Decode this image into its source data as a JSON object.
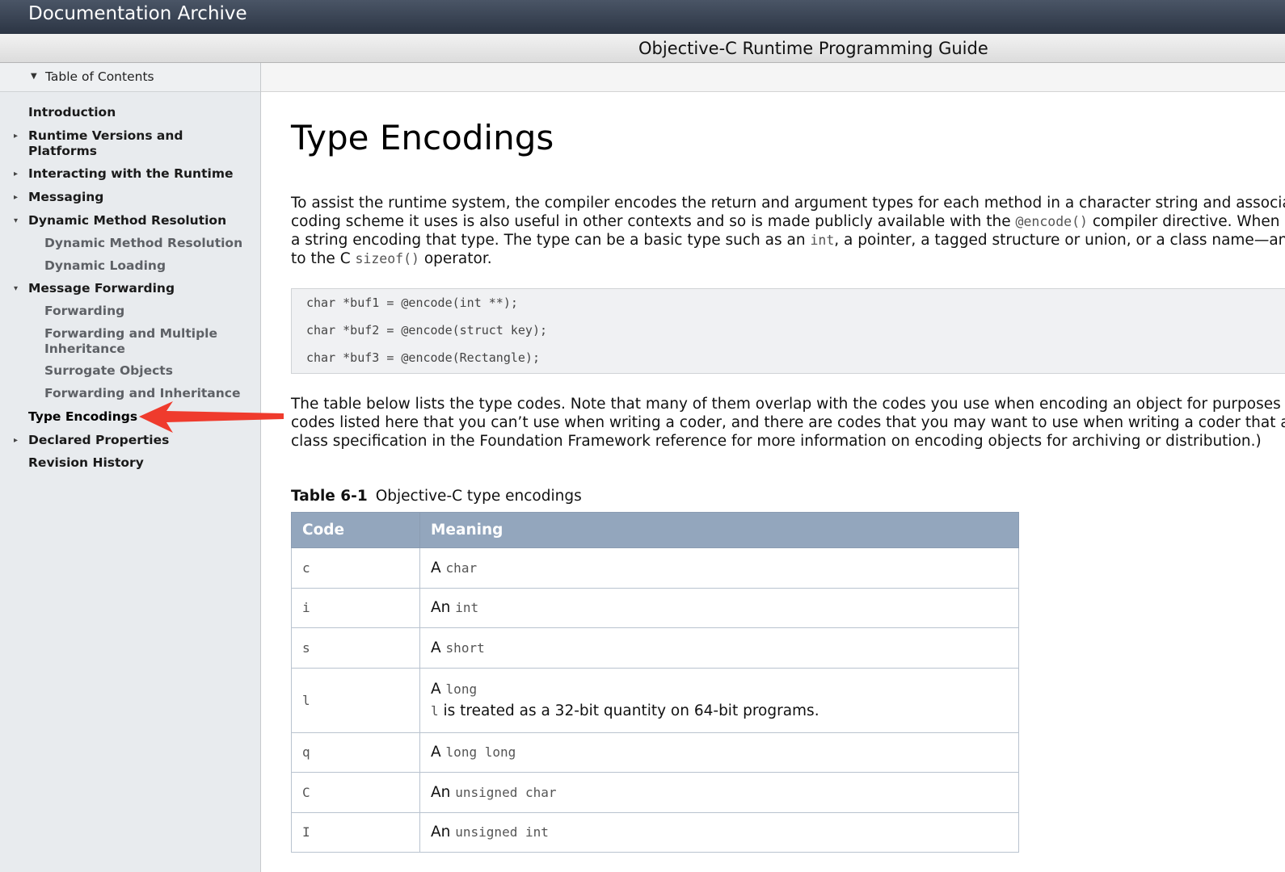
{
  "header": {
    "site_title": "Documentation Archive"
  },
  "document": {
    "title": "Objective-C Runtime Programming Guide"
  },
  "sidebar": {
    "toc_label": "Table of Contents",
    "items": [
      {
        "label": "Introduction",
        "level": 0,
        "arrow": ""
      },
      {
        "label": "Runtime Versions and",
        "label2": "Platforms",
        "level": 0,
        "arrow": "▸"
      },
      {
        "label": "Interacting with the Runtime",
        "level": 0,
        "arrow": "▸"
      },
      {
        "label": "Messaging",
        "level": 0,
        "arrow": "▸"
      },
      {
        "label": "Dynamic Method Resolution",
        "level": 0,
        "arrow": "▾"
      },
      {
        "label": "Dynamic Method Resolution",
        "level": 1,
        "arrow": ""
      },
      {
        "label": "Dynamic Loading",
        "level": 1,
        "arrow": ""
      },
      {
        "label": "Message Forwarding",
        "level": 0,
        "arrow": "▾"
      },
      {
        "label": "Forwarding",
        "level": 1,
        "arrow": ""
      },
      {
        "label": "Forwarding and Multiple",
        "label2": "Inheritance",
        "level": 1,
        "arrow": ""
      },
      {
        "label": "Surrogate Objects",
        "level": 1,
        "arrow": ""
      },
      {
        "label": "Forwarding and Inheritance",
        "level": 1,
        "arrow": ""
      },
      {
        "label": "Type Encodings",
        "level": 0,
        "arrow": "",
        "active": true
      },
      {
        "label": "Declared Properties",
        "level": 0,
        "arrow": "▸"
      },
      {
        "label": "Revision History",
        "level": 0,
        "arrow": ""
      }
    ]
  },
  "annotation": {
    "color": "#ef3b2d"
  },
  "main": {
    "title": "Type Encodings",
    "intro": {
      "l1": "To assist the runtime system, the compiler encodes the return and argument types for each method in a character string and associat",
      "l2a": "coding scheme it uses is also useful in other contexts and so is made publicly available with the ",
      "l2code": "@encode()",
      "l2b": " compiler directive. When",
      "l3a": "a string encoding that type. The type can be a basic type such as an ",
      "l3code": "int",
      "l3b": ", a pointer, a tagged structure or union, or a class name—any",
      "l4a": "to the C ",
      "l4code": "sizeof()",
      "l4b": " operator."
    },
    "code_lines": [
      "char *buf1 = @encode(int **);",
      "char *buf2 = @encode(struct key);",
      "char *buf3 = @encode(Rectangle);"
    ],
    "para2": {
      "l1": "The table below lists the type codes. Note that many of them overlap with the codes you use when encoding an object for purposes o",
      "l2": "codes listed here that you can’t use when writing a coder, and there are codes that you may want to use when writing a coder that are",
      "l3": "class specification in the Foundation Framework reference for more information on encoding objects for archiving or distribution.)"
    },
    "table": {
      "caption_num": "Table 6-1",
      "caption_text": "Objective-C type encodings",
      "headers": [
        "Code",
        "Meaning"
      ],
      "rows": [
        {
          "code": "c",
          "prefix": "A ",
          "type": "char"
        },
        {
          "code": "i",
          "prefix": "An ",
          "type": "int"
        },
        {
          "code": "s",
          "prefix": "A ",
          "type": "short"
        },
        {
          "code": "l",
          "prefix": "A ",
          "type": "long",
          "note_code": "l",
          "note_text": " is treated as a 32-bit quantity on 64-bit programs."
        },
        {
          "code": "q",
          "prefix": "A ",
          "type": "long long"
        },
        {
          "code": "C",
          "prefix": "An ",
          "type": "unsigned char"
        },
        {
          "code": "I",
          "prefix": "An ",
          "type": "unsigned int"
        }
      ]
    }
  }
}
